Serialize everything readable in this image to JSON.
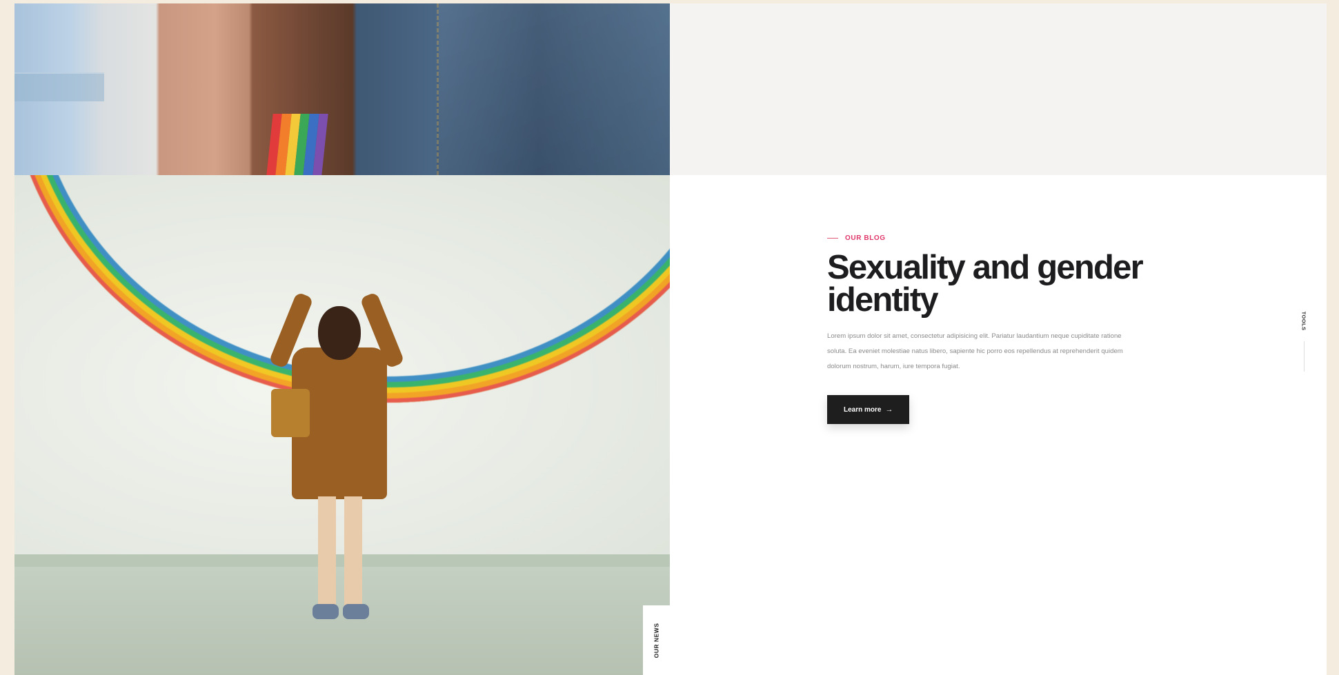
{
  "section": {
    "eyebrow": "OUR BLOG",
    "headline": "Sexuality and gender identity",
    "paragraph": "Lorem ipsum dolor sit amet, consectetur adipisicing elit. Pariatur laudantium neque cupiditate ratione soluta. Ea eveniet molestiae natus libero, sapiente hic porro eos repellendus at reprehenderit quidem dolorum nostrum, harum, iure tempora fugiat.",
    "button_label": "Learn more",
    "button_icon": "arrow-right-icon"
  },
  "side_labels": {
    "left": "OUR NEWS",
    "right": "TOOLS"
  },
  "images": {
    "top": "arms-with-rainbow-flag-photo",
    "bottom": "woman-photographing-rainbow-wall-photo"
  },
  "colors": {
    "accent": "#e0376a",
    "button_bg": "#1e1e1f",
    "headline": "#1d1d1f",
    "page_bg": "#f4ecdf"
  }
}
